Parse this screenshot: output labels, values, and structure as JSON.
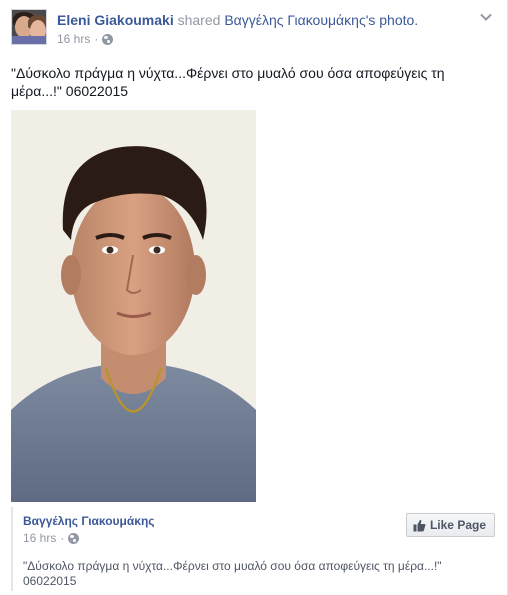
{
  "post": {
    "author": "Eleni Giakoumaki",
    "shared_word": "shared",
    "original_author": "Βαγγέλης Γιακουμάκης",
    "shared_suffix": "'s photo.",
    "timestamp": "16 hrs",
    "separator": "·",
    "text": "\"Δύσκολο πράγμα η νύχτα...Φέρνει στο μυαλό σου όσα αποφεύγεις τη μέρα...!\" 06022015"
  },
  "shared": {
    "page_name": "Βαγγέλης Γιακουμάκης",
    "timestamp": "16 hrs",
    "separator": "·",
    "text_line1": "\"Δύσκολο πράγμα η νύχτα...Φέρνει στο μυαλό σου όσα αποφεύγεις τη μέρα...!\"",
    "text_line2": "06022015",
    "like_button_label": "Like Page"
  },
  "icons": {
    "menu": "chevron-down-icon",
    "privacy": "globe-icon",
    "like": "thumbs-up-icon"
  },
  "colors": {
    "link": "#3b5998",
    "meta": "#9197a3",
    "text": "#141823"
  }
}
